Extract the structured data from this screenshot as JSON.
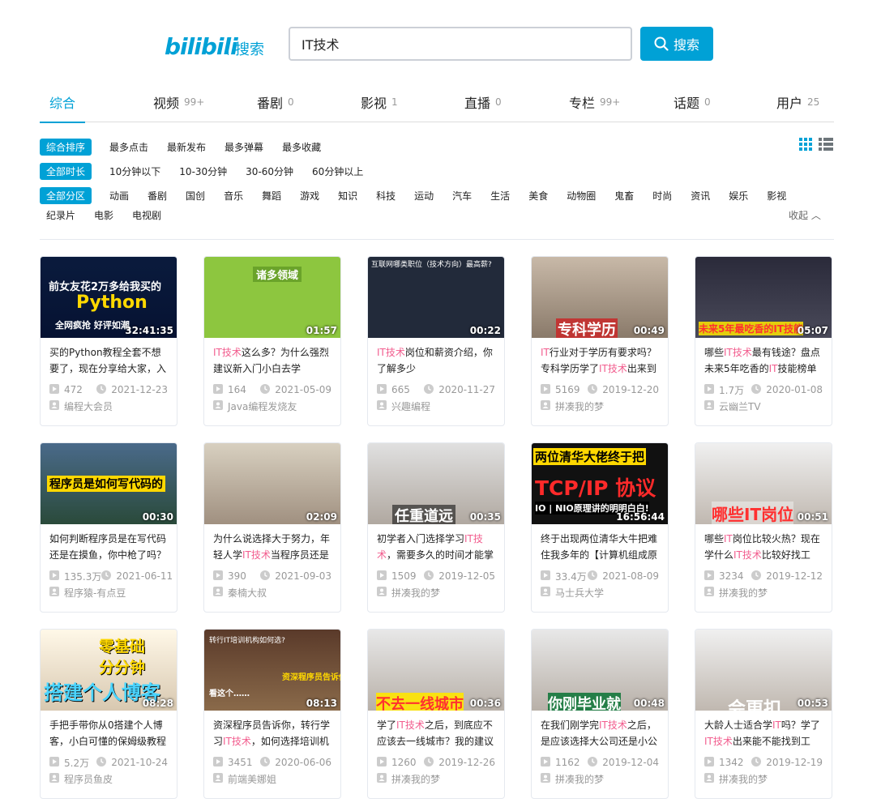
{
  "header": {
    "logo": "bilibili",
    "sub": "搜索",
    "search_value": "IT技术",
    "search_button": "搜索"
  },
  "tabs": [
    {
      "label": "综合",
      "count": ""
    },
    {
      "label": "视频",
      "count": "99+"
    },
    {
      "label": "番剧",
      "count": "0"
    },
    {
      "label": "影视",
      "count": "1"
    },
    {
      "label": "直播",
      "count": "0"
    },
    {
      "label": "专栏",
      "count": "99+"
    },
    {
      "label": "话题",
      "count": "0"
    },
    {
      "label": "用户",
      "count": "25"
    }
  ],
  "filters": {
    "order": [
      "综合排序",
      "最多点击",
      "最新发布",
      "最多弹幕",
      "最多收藏"
    ],
    "duration": [
      "全部时长",
      "10分钟以下",
      "10-30分钟",
      "30-60分钟",
      "60分钟以上"
    ],
    "zone": [
      "全部分区",
      "动画",
      "番剧",
      "国创",
      "音乐",
      "舞蹈",
      "游戏",
      "知识",
      "科技",
      "运动",
      "汽车",
      "生活",
      "美食",
      "动物圈",
      "鬼畜",
      "时尚",
      "资讯",
      "娱乐",
      "影视"
    ],
    "zone2": [
      "纪录片",
      "电影",
      "电视剧"
    ],
    "collapse": "收起"
  },
  "videos": [
    {
      "duration": "32:41:35",
      "title": "买的Python教程全套不想要了，现在分享给大家，入门",
      "views": "472",
      "date": "2021-12-23",
      "uploader": "编程大会员",
      "thumb_text": "前女友花2万多给我买的",
      "thumb_text2": "Python",
      "thumb_text3": "全网疯抢 好评如潮"
    },
    {
      "duration": "01:57",
      "title": "IT技术这么多？为什么强烈建议新入门小白去学JAVA！",
      "views": "164",
      "date": "2021-05-09",
      "uploader": "Java编程发烧友",
      "thumb_text": "诸多领域"
    },
    {
      "duration": "00:22",
      "title": "IT技术岗位和薪资介绍，你了解多少",
      "views": "665",
      "date": "2020-11-27",
      "uploader": "兴趣编程",
      "thumb_text": "互联网哪类职位（技术方向）最高薪?"
    },
    {
      "duration": "00:49",
      "title": "IT行业对于学历有要求吗？专科学历学了IT技术出来到",
      "views": "5169",
      "date": "2019-12-20",
      "uploader": "拼凑我的梦",
      "thumb_text": "专科学历"
    },
    {
      "duration": "05:07",
      "title": "哪些IT技术最有钱途？盘点未来5年吃香的IT技能榜单",
      "views": "1.7万",
      "date": "2020-01-08",
      "uploader": "云幽兰TV",
      "thumb_text": "未来5年最吃香的IT技能"
    },
    {
      "duration": "00:30",
      "title": "如何判断程序员是在写代码还是在摸鱼，你中枪了吗？",
      "views": "135.3万",
      "date": "2021-06-11",
      "uploader": "程序猿-有点豆",
      "thumb_text": "程序员是如何写代码的"
    },
    {
      "duration": "02:09",
      "title": "为什么说选择大于努力，年轻人学IT技术当程序员还是",
      "views": "390",
      "date": "2021-09-03",
      "uploader": "秦楠大叔",
      "thumb_text": ""
    },
    {
      "duration": "00:35",
      "title": "初学者入门选择学习IT技术，需要多久的时间才能掌",
      "views": "1509",
      "date": "2019-12-05",
      "uploader": "拼凑我的梦",
      "thumb_text": "任重道远"
    },
    {
      "duration": "16:56:44",
      "title": "终于出现两位清华大牛把难住我多年的【计算机组成原",
      "views": "33.4万",
      "date": "2021-08-09",
      "uploader": "马士兵大学",
      "thumb_text": "两位清华大佬终于把",
      "thumb_text2": "TCP/IP 协议",
      "thumb_text3": "IO | NIO原理讲的明明白白!"
    },
    {
      "duration": "00:51",
      "title": "哪些IT岗位比较火热？现在学什么IT技术比较好找工",
      "views": "3234",
      "date": "2019-12-12",
      "uploader": "拼凑我的梦",
      "thumb_text": "哪些IT岗位"
    },
    {
      "duration": "08:28",
      "title": "手把手带你从0搭建个人博客，小白可懂的保姆级教程",
      "views": "5.2万",
      "date": "2021-10-24",
      "uploader": "程序员鱼皮",
      "thumb_text": "零基础",
      "thumb_text2": "分分钟",
      "thumb_text3": "搭建个人博客"
    },
    {
      "duration": "08:13",
      "title": "资深程序员告诉你，转行学习IT技术，如何选择培训机",
      "views": "3451",
      "date": "2020-06-06",
      "uploader": "前端美娜姐",
      "thumb_text": "转行IT培训机构如何选?",
      "thumb_text2": "资深程序员告诉你",
      "thumb_text3": "看这个……"
    },
    {
      "duration": "00:36",
      "title": "学了IT技术之后，到底应不应该去一线城市？我的建议",
      "views": "1260",
      "date": "2019-12-26",
      "uploader": "拼凑我的梦",
      "thumb_text": "不去一线城市"
    },
    {
      "duration": "00:48",
      "title": "在我们刚学完IT技术之后，是应该选择大公司还是小公",
      "views": "1162",
      "date": "2019-12-04",
      "uploader": "拼凑我的梦",
      "thumb_text": "你刚毕业就"
    },
    {
      "duration": "00:53",
      "title": "大龄人士适合学IT吗？学了IT技术出来能不能找到工",
      "views": "1342",
      "date": "2019-12-19",
      "uploader": "拼凑我的梦",
      "thumb_text": "会更扣"
    }
  ],
  "colors": {
    "accent": "#00a1d6",
    "highlight": "#f25d8e"
  }
}
